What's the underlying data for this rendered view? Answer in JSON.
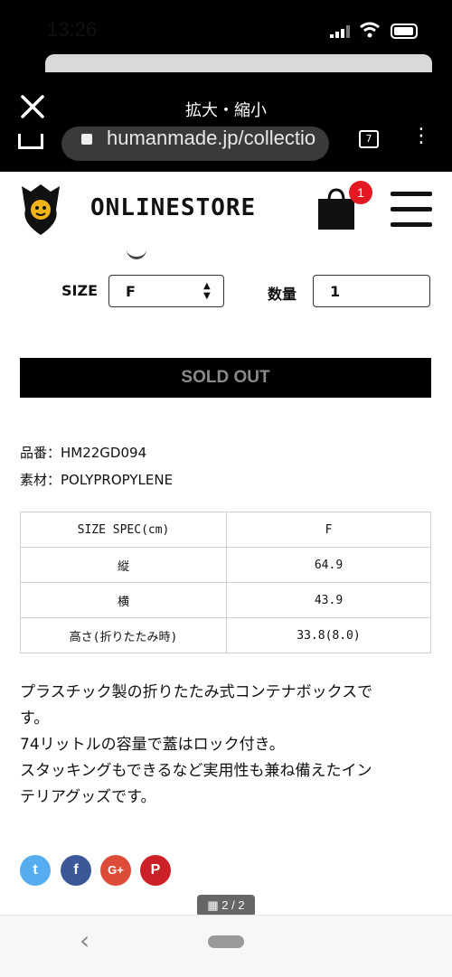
{
  "status_bar": {
    "time": "13:26"
  },
  "viewer": {
    "title": "拡大・縮小",
    "url": "humanmade.jp/collectio",
    "tab_count": "7"
  },
  "header": {
    "store_title": "ONLINESTORE",
    "cart_count": "1"
  },
  "size": {
    "label": "SIZE",
    "value": "F"
  },
  "quantity": {
    "label": "数量",
    "value": "1"
  },
  "sold_out_label": "SOLD OUT",
  "product": {
    "code": "品番：HM22GD094",
    "material": "素材：POLYPROPYLENE"
  },
  "spec_table": {
    "header": [
      "SIZE SPEC(cm)",
      "F"
    ],
    "rows": [
      [
        "縦",
        "64.9"
      ],
      [
        "横",
        "43.9"
      ],
      [
        "高さ(折りたたみ時)",
        "33.8(8.0)"
      ]
    ]
  },
  "description": [
    "プラスチック製の折りたたみ式コンテナボックスで",
    "す。",
    "74リットルの容量で蓋はロック付き。",
    "スタッキングもできるなど実用性も兼ね備えたイン",
    "テリアグッズです。"
  ],
  "social": [
    {
      "icon": "twitter-icon",
      "glyph": "t",
      "color": "#55acee"
    },
    {
      "icon": "facebook-icon",
      "glyph": "f",
      "color": "#3b5998"
    },
    {
      "icon": "google-plus-icon",
      "glyph": "G+",
      "color": "#dd4b39"
    },
    {
      "icon": "pinterest-icon",
      "glyph": "P",
      "color": "#cb2027"
    }
  ],
  "pager": "2 / 2"
}
